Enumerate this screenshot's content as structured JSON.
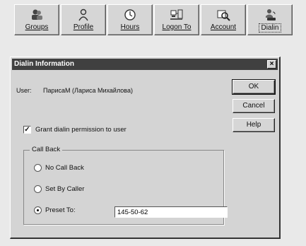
{
  "toolbar": {
    "buttons": [
      {
        "label": "Groups",
        "icon": "groups-icon"
      },
      {
        "label": "Profile",
        "icon": "profile-icon"
      },
      {
        "label": "Hours",
        "icon": "clock-icon"
      },
      {
        "label": "Logon To",
        "icon": "logon-icon"
      },
      {
        "label": "Account",
        "icon": "account-icon"
      },
      {
        "label": "Dialin",
        "icon": "dialin-icon",
        "active": true
      }
    ]
  },
  "dialog": {
    "title": "Dialin Information",
    "close_glyph": "×",
    "user_label": "User:",
    "user_value": "ПарисаМ (Лариса Михайлова)",
    "ok_label": "OK",
    "cancel_label": "Cancel",
    "help_label": "Help",
    "grant_label": "Grant dialin permission to user",
    "grant_checked": true,
    "callback_group_label": "Call Back",
    "options": {
      "no_callback": "No Call Back",
      "set_by_caller": "Set By Caller",
      "preset_to": "Preset To:"
    },
    "selected_option": "preset_to",
    "preset_value": "145-50-62"
  }
}
